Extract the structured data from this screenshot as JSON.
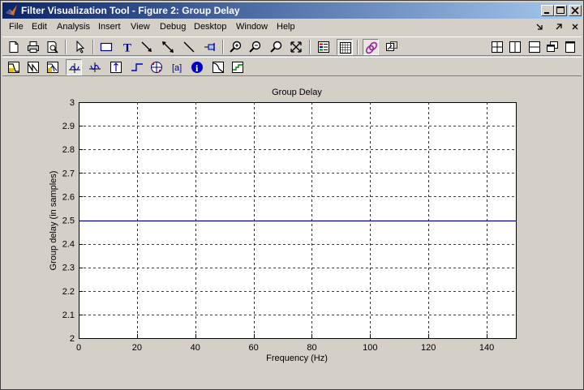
{
  "window": {
    "title": "Filter Visualization Tool - Figure 2: Group Delay",
    "controls": [
      "minimize-icon",
      "maximize-icon",
      "close-icon"
    ]
  },
  "menu": {
    "items": [
      "File",
      "Edit",
      "Analysis",
      "Insert",
      "View",
      "Debug",
      "Desktop",
      "Window",
      "Help"
    ]
  },
  "toolbar1": {
    "icons": [
      "new-figure-icon",
      "print-icon",
      "print-preview-icon",
      "select-arrow-icon",
      "rectangle-icon",
      "text-icon",
      "arrow-icon",
      "double-arrow-icon",
      "line-icon",
      "pin-icon",
      "zoom-in-icon",
      "zoom-out-icon",
      "zoom-x-icon",
      "zoom-fit-icon",
      "legend-icon",
      "grid-icon",
      "link-icon",
      "new-window-icon"
    ],
    "layout_icons": [
      "tile-grid-icon",
      "tile-columns-icon",
      "tile-rows-icon",
      "cascade-icon",
      "float-icon"
    ]
  },
  "toolbar2": {
    "icons": [
      "magnitude-response-icon",
      "phase-response-icon",
      "magnitude-phase-icon",
      "group-delay-icon",
      "phase-delay-icon",
      "impulse-response-icon",
      "step-response-icon",
      "pole-zero-icon",
      "coefficients-icon",
      "filter-info-icon",
      "magnitude-estimate-icon",
      "noise-psd-icon"
    ]
  },
  "colors": {
    "titlebar_start": "#0a246a",
    "titlebar_end": "#a6caf0",
    "plot_line": "#000080",
    "face": "#d4d0c8"
  },
  "chart_data": {
    "type": "line",
    "title": "Group Delay",
    "xlabel": "Frequency (Hz)",
    "ylabel": "Group delay (in samples)",
    "xlim": [
      0,
      150
    ],
    "ylim": [
      2,
      3
    ],
    "xticks": [
      0,
      20,
      40,
      60,
      80,
      100,
      120,
      140
    ],
    "yticks": [
      2,
      2.1,
      2.2,
      2.3,
      2.4,
      2.5,
      2.6,
      2.7,
      2.8,
      2.9,
      3
    ],
    "grid": true,
    "series": [
      {
        "x": [
          0,
          150
        ],
        "y": [
          2.5,
          2.5
        ],
        "color": "#000080"
      }
    ]
  }
}
